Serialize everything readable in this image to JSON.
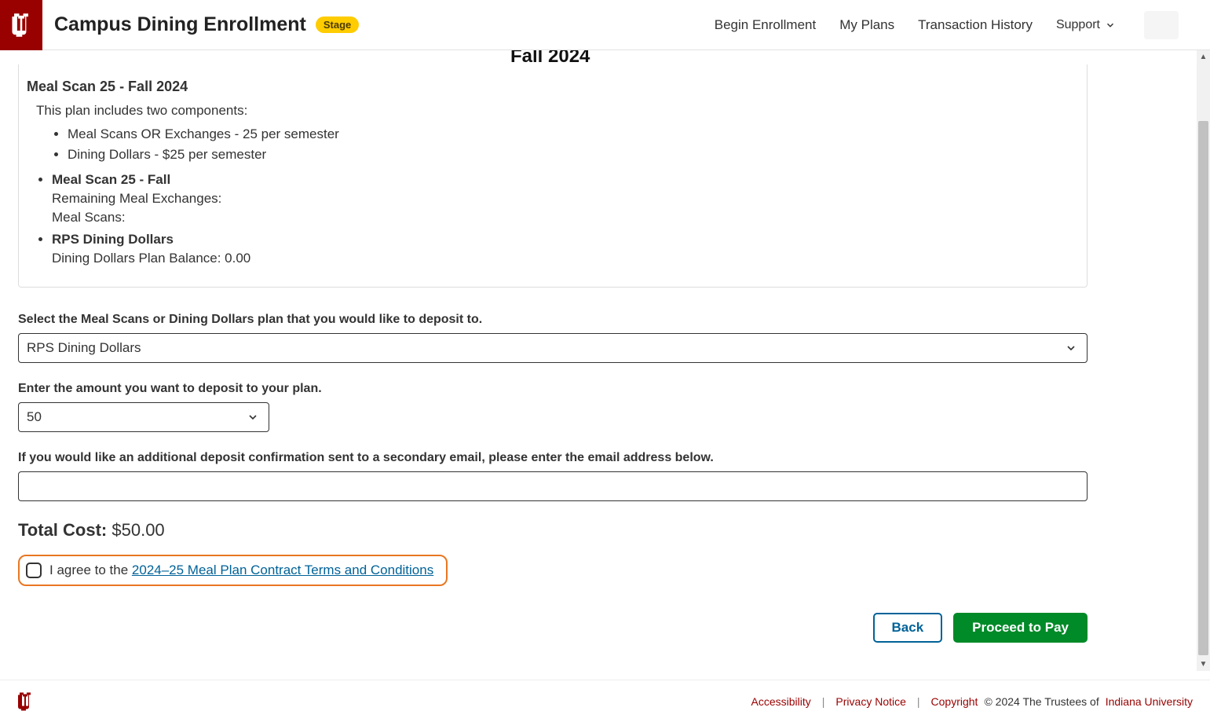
{
  "header": {
    "app_title": "Campus Dining Enrollment",
    "badge": "Stage",
    "nav": {
      "begin": "Begin Enrollment",
      "my_plans": "My Plans",
      "history": "Transaction History",
      "support": "Support"
    }
  },
  "partial_heading": "Fall 2024",
  "plan_card": {
    "title": "Meal Scan 25 - Fall 2024",
    "intro": "This plan includes two components:",
    "components": {
      "c1": "Meal Scans OR Exchanges - 25 per semester",
      "c2": "Dining Dollars - $25 per semester"
    },
    "sub1": {
      "label": "Meal Scan 25 - Fall",
      "line1": "Remaining Meal Exchanges:",
      "line2": "Meal Scans:"
    },
    "sub2": {
      "label": "RPS Dining Dollars",
      "line1": "Dining Dollars Plan Balance: 0.00"
    }
  },
  "form": {
    "select_plan_label": "Select the Meal Scans or Dining Dollars plan that you would like to deposit to.",
    "select_plan_value": "RPS Dining Dollars",
    "amount_label": "Enter the amount you want to deposit to your plan.",
    "amount_value": "50",
    "email_label": "If you would like an additional deposit confirmation sent to a secondary email, please enter the email address below.",
    "email_value": ""
  },
  "total": {
    "label": "Total Cost:",
    "value": "$50.00"
  },
  "agree": {
    "prefix": "I agree to the ",
    "link": "2024–25 Meal Plan Contract Terms and Conditions"
  },
  "buttons": {
    "back": "Back",
    "proceed": "Proceed to Pay"
  },
  "footer": {
    "accessibility": "Accessibility",
    "privacy": "Privacy Notice",
    "copyright_label": "Copyright",
    "copyright_text": " © 2024 The Trustees of ",
    "iu": "Indiana University"
  }
}
